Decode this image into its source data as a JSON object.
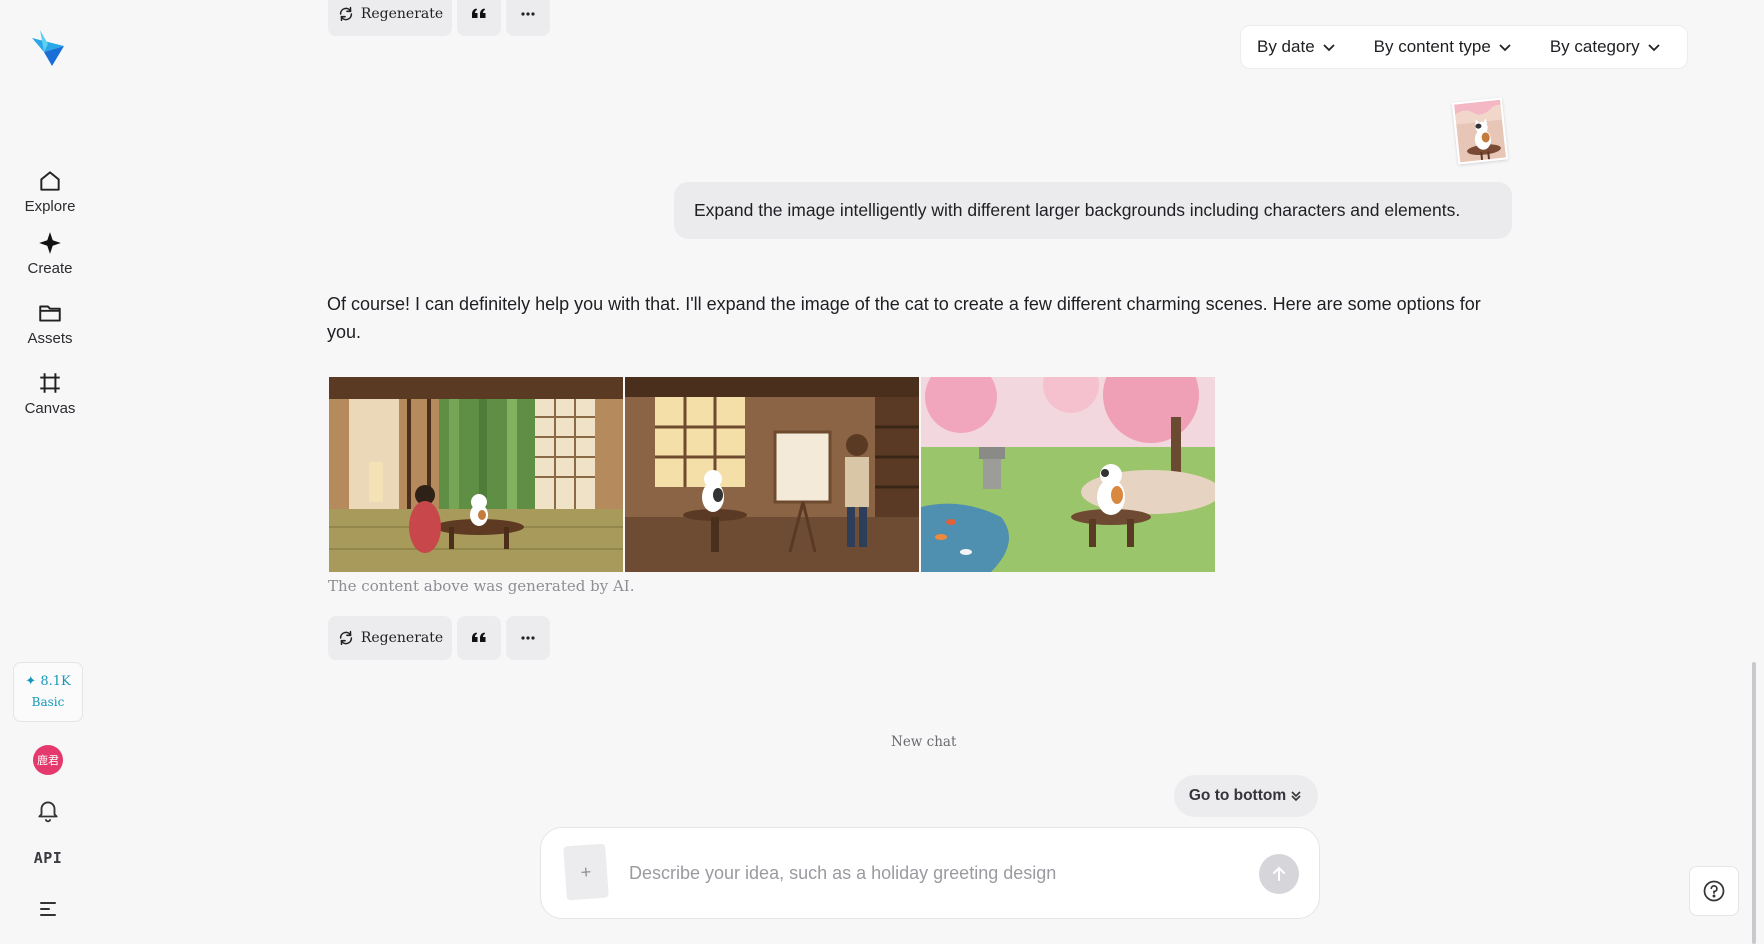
{
  "nav": {
    "items": [
      {
        "label": "Explore",
        "icon": "home-icon"
      },
      {
        "label": "Create",
        "icon": "sparkle-icon"
      },
      {
        "label": "Assets",
        "icon": "folder-icon"
      },
      {
        "label": "Canvas",
        "icon": "crop-icon"
      }
    ],
    "credits": {
      "amount": "8.1K",
      "tier": "Basic"
    },
    "avatar_text": "鹿君",
    "api_label": "API"
  },
  "filters": {
    "date": "By date",
    "content_type": "By content type",
    "category": "By category"
  },
  "actions": {
    "regenerate": "Regenerate"
  },
  "conversation": {
    "user_message": "Expand the image intelligently with different larger backgrounds including characters and elements.",
    "ai_response": "Of course! I can definitely help you with that. I'll expand the image of the cat to create a few different charming scenes. Here are some options for you.",
    "ai_note": "The content above was generated by AI.",
    "new_chat": "New chat"
  },
  "composer": {
    "go_to_bottom": "Go to bottom",
    "attach": "+",
    "placeholder": "Describe your idea, such as a holiday greeting design"
  },
  "colors": {
    "accent": "#1697b8",
    "avatar_bg": "#e5396e",
    "background": "#f7f7f8"
  }
}
